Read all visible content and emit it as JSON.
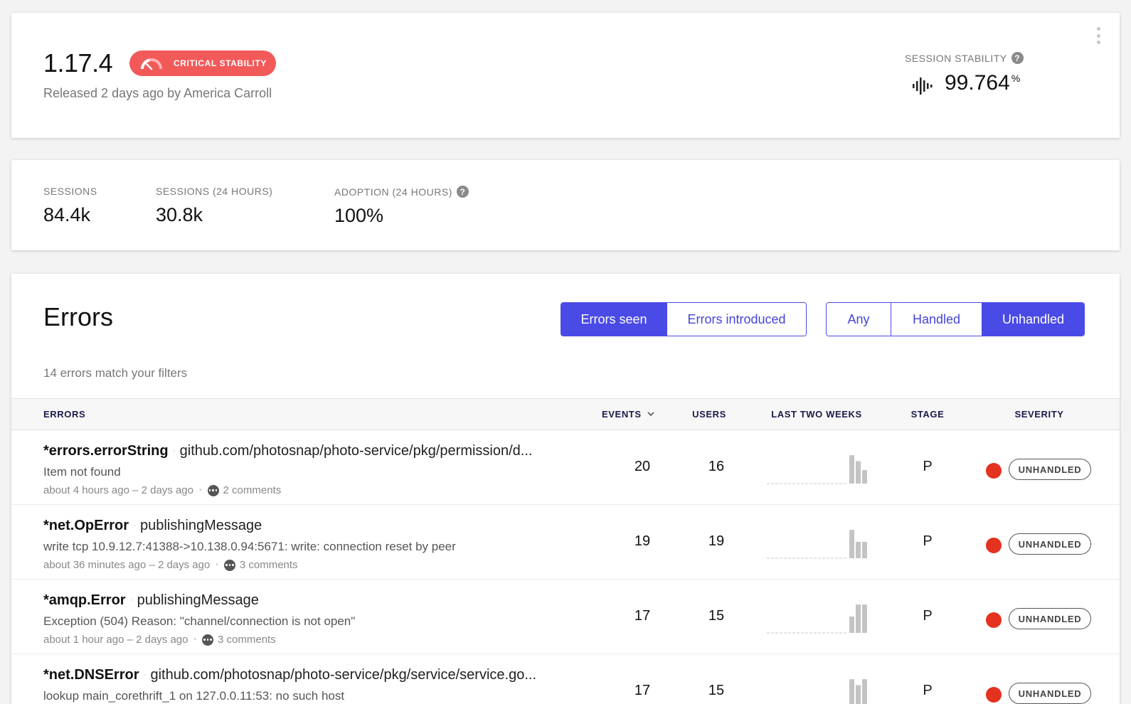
{
  "release": {
    "version": "1.17.4",
    "badge": "CRITICAL STABILITY",
    "released": "Released 2 days ago by America Carroll",
    "stability_label": "SESSION STABILITY",
    "stability_value": "99.764",
    "stability_unit": "%"
  },
  "metrics": [
    {
      "label": "SESSIONS",
      "value": "84.4k"
    },
    {
      "label": "SESSIONS (24 HOURS)",
      "value": "30.8k"
    },
    {
      "label": "ADOPTION (24 HOURS)",
      "value": "100%"
    }
  ],
  "errors": {
    "title": "Errors",
    "filter_scope": [
      "Errors seen",
      "Errors introduced"
    ],
    "filter_scope_active": "Errors seen",
    "filter_handled": [
      "Any",
      "Handled",
      "Unhandled"
    ],
    "filter_handled_active": "Unhandled",
    "match_text": "14 errors match your filters",
    "columns": [
      "ERRORS",
      "EVENTS",
      "USERS",
      "LAST TWO WEEKS",
      "STAGE",
      "SEVERITY"
    ],
    "rows": [
      {
        "class": "*errors.errorString",
        "location": "github.com/photosnap/photo-service/pkg/permission/d...",
        "message": "Item not found",
        "time": "about 4 hours ago – 2 days ago",
        "comments": "2 comments",
        "events": "20",
        "users": "16",
        "trend": [
          0.95,
          0.75,
          0.45
        ],
        "stage": "P",
        "severity": "UNHANDLED"
      },
      {
        "class": "*net.OpError",
        "location": "publishingMessage",
        "message": "write tcp 10.9.12.7:41388->10.138.0.94:5671: write: connection reset by peer",
        "time": "about 36 minutes ago – 2 days ago",
        "comments": "3 comments",
        "events": "19",
        "users": "19",
        "trend": [
          0.95,
          0.55,
          0.55
        ],
        "stage": "P",
        "severity": "UNHANDLED"
      },
      {
        "class": "*amqp.Error",
        "location": "publishingMessage",
        "message": "Exception (504) Reason: \"channel/connection is not open\"",
        "time": "about 1 hour ago – 2 days ago",
        "comments": "3 comments",
        "events": "17",
        "users": "15",
        "trend": [
          0.55,
          0.95,
          0.95
        ],
        "stage": "P",
        "severity": "UNHANDLED"
      },
      {
        "class": "*net.DNSError",
        "location": "github.com/photosnap/photo-service/pkg/service/service.go...",
        "message": "lookup main_corethrift_1 on 127.0.0.11:53: no such host",
        "time": "",
        "comments": "",
        "events": "17",
        "users": "15",
        "trend": [
          0.95,
          0.75,
          0.95
        ],
        "stage": "P",
        "severity": "UNHANDLED"
      }
    ]
  },
  "colors": {
    "accent": "#4a4ae6",
    "critical": "#f25a5a",
    "severity": "#e4321e"
  }
}
